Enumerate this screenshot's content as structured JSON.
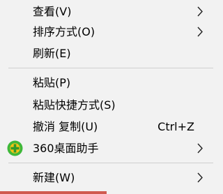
{
  "menu": {
    "items": [
      {
        "label": "查看(V)"
      },
      {
        "label": "排序方式(O)"
      },
      {
        "label": "刷新(E)"
      },
      {
        "label": "粘贴(P)"
      },
      {
        "label": "粘贴快捷方式(S)"
      },
      {
        "label": "撤消 复制(U)",
        "shortcut": "Ctrl+Z"
      },
      {
        "label": "360桌面助手"
      },
      {
        "label": "新建(W)"
      }
    ]
  },
  "icons": {
    "submenu_arrow": "chevron-right-icon",
    "app_360": "360-desktop-assistant-icon"
  },
  "colors": {
    "menu_background": "#f2f2f2",
    "separator": "#cfcfcf",
    "icon_green": "#3fb83a",
    "icon_yellow": "#f3c316",
    "bottom_accent": "#d05a50"
  }
}
